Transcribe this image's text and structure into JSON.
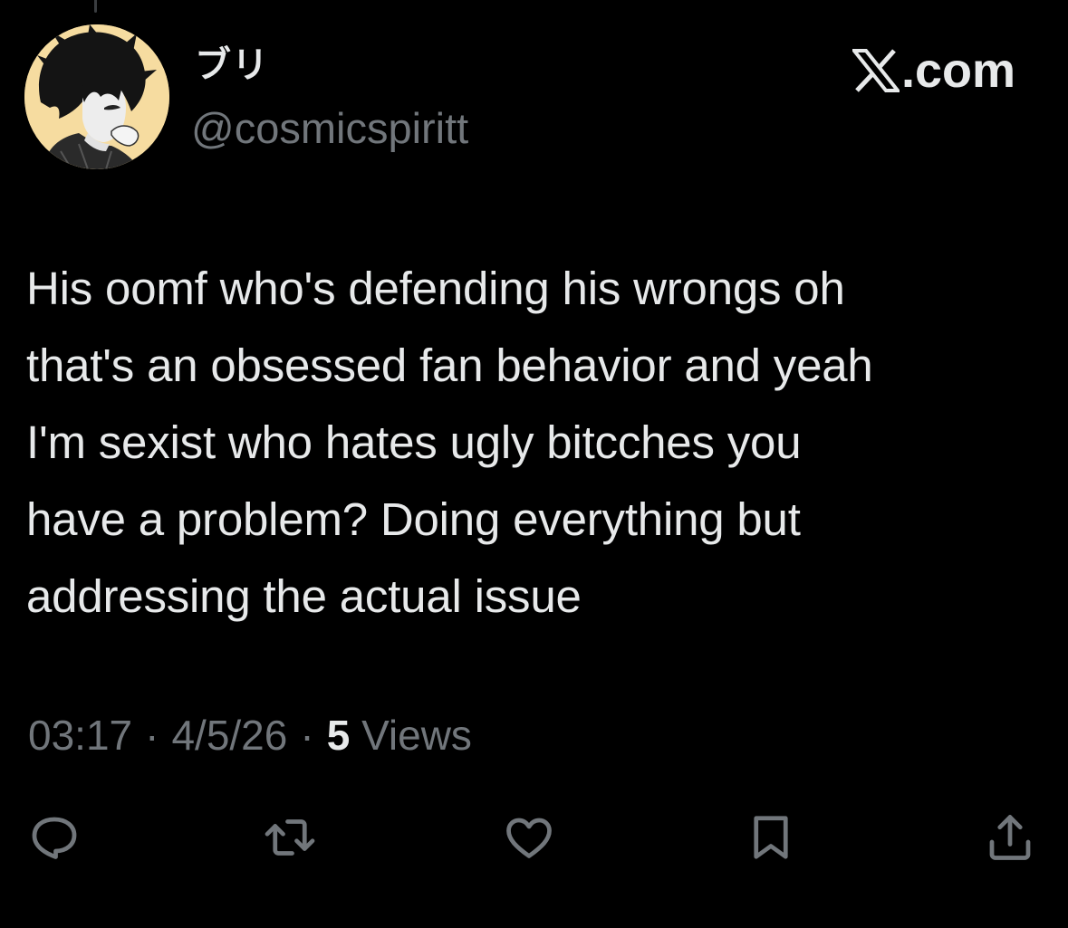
{
  "author": {
    "display_name": "ブリ",
    "handle": "@cosmicspiritt",
    "avatar": "avatar-illustration"
  },
  "brand": {
    "logo_icon": "x-logo-icon",
    "text": ".com"
  },
  "tweet": {
    "text": "His oomf who's defending his wrongs oh\nthat's an obsessed fan behavior and yeah\nI'm sexist who hates ugly bitcches you\nhave a problem? Doing everything but\naddressing the actual issue"
  },
  "meta": {
    "time": "03:17",
    "separator": "·",
    "date": "4/5/26",
    "views_count": "5",
    "views_label": "Views"
  },
  "actions": [
    {
      "name": "reply",
      "icon": "reply-icon"
    },
    {
      "name": "retweet",
      "icon": "retweet-icon"
    },
    {
      "name": "like",
      "icon": "heart-icon"
    },
    {
      "name": "bookmark",
      "icon": "bookmark-icon"
    },
    {
      "name": "share",
      "icon": "share-icon"
    }
  ],
  "colors": {
    "background": "#000000",
    "primary_text": "#e7e9ea",
    "secondary_text": "#71767b",
    "avatar_background": "#f6dca0"
  }
}
